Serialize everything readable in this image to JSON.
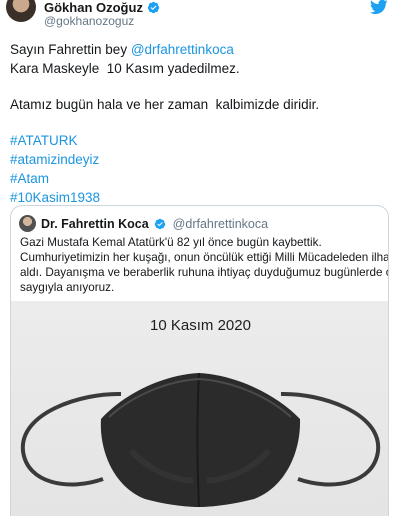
{
  "tweet": {
    "author_name": "Gökhan Ozoğuz",
    "author_handle": "@gokhanozoguz",
    "lines": [
      {
        "prefix": "Sayın Fahrettin bey ",
        "mention": "@drfahrettinkoca"
      },
      {
        "text": "Kara Maskeyle  10 Kasım yadedilmez."
      },
      {
        "text": "Atamız bugün hala ve her zaman  kalbimizde diridir."
      }
    ],
    "hashtags": [
      "#ATATURK",
      "#atamizindeyiz",
      "#Atam",
      "#10Kasim1938"
    ]
  },
  "quoted_tweet": {
    "author_name": "Dr. Fahrettin Koca",
    "author_handle": "@drfahrettinkoca",
    "lines": [
      "Gazi Mustafa Kemal Atatürk'ü 82 yıl önce bugün kaybettik.",
      "Cumhuriyetimizin her kuşağı, onun öncülük ettiği Milli Mücadeleden ilham",
      "aldı. Dayanışma ve beraberlik ruhuna ihtiyaç duyduğumuz bugünlerde onu",
      "saygıyla anıyoruz."
    ],
    "image_caption": "10 Kasım 2020"
  },
  "icons": {
    "verified": "verified-badge-icon",
    "twitter": "twitter-bird-icon"
  },
  "colors": {
    "link": "#1b95e0",
    "verified": "#1da1f2",
    "secondary_text": "#657786",
    "mask": "#2b2b2b"
  }
}
